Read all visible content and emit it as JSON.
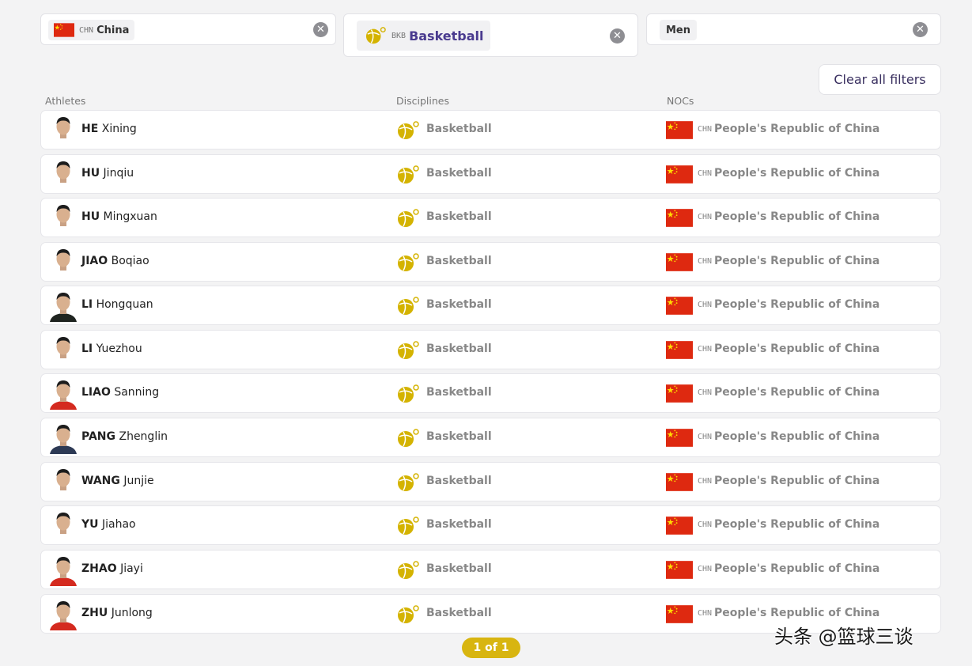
{
  "filters": {
    "noc": {
      "code": "CHN",
      "label": "China"
    },
    "discipline": {
      "code": "BKB",
      "label": "Basketball"
    },
    "gender": {
      "label": "Men"
    },
    "clear_all_label": "Clear all filters"
  },
  "columns": {
    "athletes": "Athletes",
    "disciplines": "Disciplines",
    "nocs": "NOCs"
  },
  "athletes": [
    {
      "last": "HE",
      "first": "Xining",
      "discipline": "Basketball",
      "noc_code": "CHN",
      "noc_name": "People's Republic of China",
      "shirt": "#ffffff"
    },
    {
      "last": "HU",
      "first": "Jinqiu",
      "discipline": "Basketball",
      "noc_code": "CHN",
      "noc_name": "People's Republic of China",
      "shirt": "#ffffff"
    },
    {
      "last": "HU",
      "first": "Mingxuan",
      "discipline": "Basketball",
      "noc_code": "CHN",
      "noc_name": "People's Republic of China",
      "shirt": "#ffffff"
    },
    {
      "last": "JIAO",
      "first": "Boqiao",
      "discipline": "Basketball",
      "noc_code": "CHN",
      "noc_name": "People's Republic of China",
      "shirt": "#ffffff"
    },
    {
      "last": "LI",
      "first": "Hongquan",
      "discipline": "Basketball",
      "noc_code": "CHN",
      "noc_name": "People's Republic of China",
      "shirt": "#1f2420"
    },
    {
      "last": "LI",
      "first": "Yuezhou",
      "discipline": "Basketball",
      "noc_code": "CHN",
      "noc_name": "People's Republic of China",
      "shirt": "#ffffff"
    },
    {
      "last": "LIAO",
      "first": "Sanning",
      "discipline": "Basketball",
      "noc_code": "CHN",
      "noc_name": "People's Republic of China",
      "shirt": "#d42a1f"
    },
    {
      "last": "PANG",
      "first": "Zhenglin",
      "discipline": "Basketball",
      "noc_code": "CHN",
      "noc_name": "People's Republic of China",
      "shirt": "#2d3a55"
    },
    {
      "last": "WANG",
      "first": "Junjie",
      "discipline": "Basketball",
      "noc_code": "CHN",
      "noc_name": "People's Republic of China",
      "shirt": "#ffffff"
    },
    {
      "last": "YU",
      "first": "Jiahao",
      "discipline": "Basketball",
      "noc_code": "CHN",
      "noc_name": "People's Republic of China",
      "shirt": "#ffffff"
    },
    {
      "last": "ZHAO",
      "first": "Jiayi",
      "discipline": "Basketball",
      "noc_code": "CHN",
      "noc_name": "People's Republic of China",
      "shirt": "#d42a1f"
    },
    {
      "last": "ZHU",
      "first": "Junlong",
      "discipline": "Basketball",
      "noc_code": "CHN",
      "noc_name": "People's Republic of China",
      "shirt": "#d42a1f"
    }
  ],
  "pagination": {
    "label": "1 of 1"
  },
  "watermark": "头条 @篮球三谈",
  "colors": {
    "flag_red": "#de2910",
    "flag_star": "#ffde00",
    "accent_gold": "#d8b510",
    "basketball_gold": "#d4b300"
  }
}
